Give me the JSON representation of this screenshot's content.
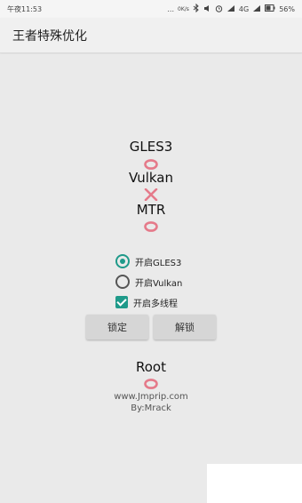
{
  "status_bar": {
    "time": "午夜11:53",
    "dots": "...",
    "net_speed": "0K/s",
    "network": "4G",
    "battery": "56%"
  },
  "app_bar": {
    "title": "王者特殊优化"
  },
  "status": {
    "gles3": {
      "label": "GLES3",
      "mark": "circle"
    },
    "vulkan": {
      "label": "Vulkan",
      "mark": "cross"
    },
    "mtr": {
      "label": "MTR",
      "mark": "circle"
    },
    "root": {
      "label": "Root",
      "mark": "circle"
    }
  },
  "options": {
    "enable_gles3": {
      "label": "开启GLES3",
      "checked": true
    },
    "enable_vulkan": {
      "label": "开启Vulkan",
      "checked": false
    },
    "enable_multithread": {
      "label": "开启多线程",
      "checked": true
    }
  },
  "buttons": {
    "lock": "锁定",
    "unlock": "解锁"
  },
  "footer": {
    "website": "www.Jmprip.com",
    "author": "By:Mrack"
  },
  "colors": {
    "accent": "#1f9a8a",
    "ok_mark": "#e57a8a",
    "background": "#eaeaea"
  }
}
